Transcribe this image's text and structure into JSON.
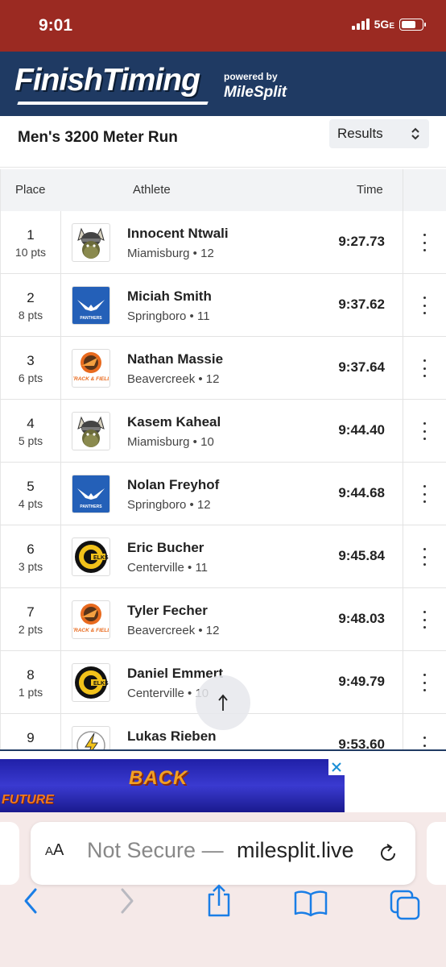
{
  "status_bar": {
    "time": "9:01",
    "network": "5G",
    "network_suffix": "E"
  },
  "header": {
    "logo": "FinishTiming",
    "powered_by": "powered by",
    "partner": "MileSplit"
  },
  "event": {
    "title": "Men's 3200 Meter Run",
    "view_select": "Results"
  },
  "table": {
    "columns": {
      "place": "Place",
      "athlete": "Athlete",
      "time": "Time"
    },
    "rows": [
      {
        "place": "1",
        "points": "10 pts",
        "name": "Innocent Ntwali",
        "school": "Miamisburg • 12",
        "time": "9:27.73",
        "logo": "viking-icon"
      },
      {
        "place": "2",
        "points": "8 pts",
        "name": "Miciah Smith",
        "school": "Springboro • 11",
        "time": "9:37.62",
        "logo": "panthers-icon"
      },
      {
        "place": "3",
        "points": "6 pts",
        "name": "Nathan Massie",
        "school": "Beavercreek • 12",
        "time": "9:37.64",
        "logo": "beaver-icon"
      },
      {
        "place": "4",
        "points": "5 pts",
        "name": "Kasem Kaheal",
        "school": "Miamisburg • 10",
        "time": "9:44.40",
        "logo": "viking-icon"
      },
      {
        "place": "5",
        "points": "4 pts",
        "name": "Nolan Freyhof",
        "school": "Springboro • 12",
        "time": "9:44.68",
        "logo": "panthers-icon"
      },
      {
        "place": "6",
        "points": "3 pts",
        "name": "Eric Bucher",
        "school": "Centerville • 11",
        "time": "9:45.84",
        "logo": "elks-icon"
      },
      {
        "place": "7",
        "points": "2 pts",
        "name": "Tyler Fecher",
        "school": "Beavercreek • 12",
        "time": "9:48.03",
        "logo": "beaver-icon"
      },
      {
        "place": "8",
        "points": "1 pts",
        "name": "Daniel Emmert",
        "school": "Centerville • 10",
        "time": "9:49.79",
        "logo": "elks-icon"
      },
      {
        "place": "9",
        "points": "",
        "name": "Lukas Rieben",
        "school": "",
        "time": "9:53.60",
        "logo": "lightning-icon"
      }
    ]
  },
  "logo_text": {
    "panthers": "PANTHERS",
    "elks": "ELKS",
    "beaver": "TRACK & FIELD"
  },
  "ad": {
    "text_back": "BACK",
    "text_future": "FUTURE"
  },
  "browser": {
    "aa": "AA",
    "not_secure": "Not Secure —",
    "host": "milesplit.live"
  },
  "colors": {
    "status_bar": "#9b2a22",
    "header": "#1f3a63",
    "ad": "#2a2ab8",
    "safari": "#f5e9e8"
  }
}
